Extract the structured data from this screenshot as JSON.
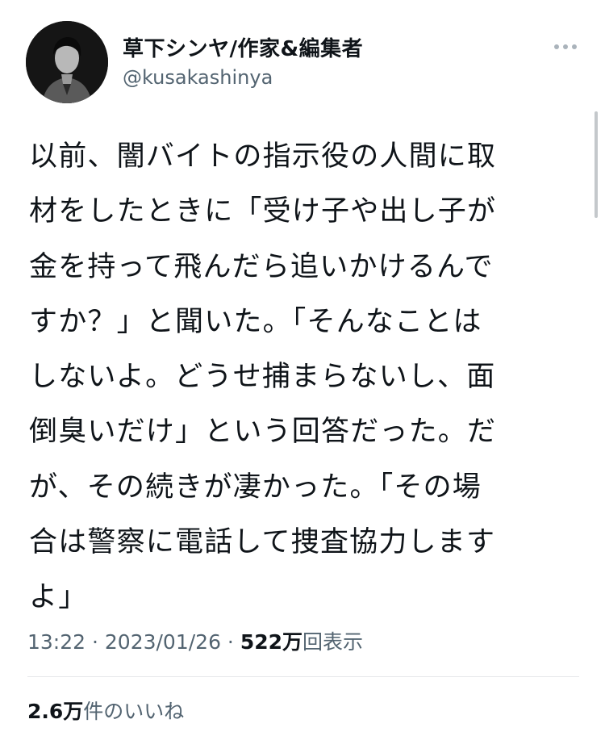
{
  "author": {
    "display_name": "草下シンヤ/作家&編集者",
    "handle": "@kusakashinya",
    "avatar_icon": "profile-photo"
  },
  "more_icon": "more-horizontal-icon",
  "tweet": {
    "lines": [
      "以前、闇バイトの指示役の人間に取",
      "材をしたときに「受け子や出し子が",
      "金を持って飛んだら追いかけるんで",
      "すか？」と聞いた。「そんなことは",
      "しないよ。どうせ捕まらないし、面",
      "倒臭いだけ」という回答だった。だ",
      "が、その続きが凄かった。「その場",
      "合は警察に電話して捜査協力します",
      "よ」"
    ]
  },
  "meta": {
    "time": "13:22",
    "separator": " · ",
    "date": "2023/01/26",
    "views_count": "522万",
    "views_label": "回表示"
  },
  "stats": {
    "likes_count": "2.6万",
    "likes_label": "件のいいね"
  }
}
